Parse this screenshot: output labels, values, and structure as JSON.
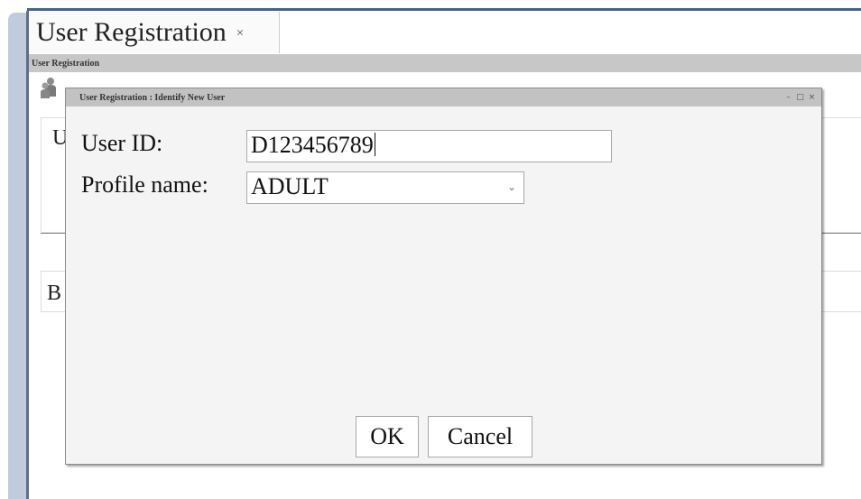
{
  "tab": {
    "title": "User Registration",
    "close_glyph": "×"
  },
  "breadcrumb": "User Registration",
  "background": {
    "fragment_u": "U",
    "fragment_b": "B"
  },
  "dialog": {
    "title": "User Registration : Identify New User",
    "controls": {
      "minimize": "–",
      "maximize": "□",
      "close": "×"
    },
    "user_id_label": "User ID:",
    "user_id_value": "D123456789",
    "profile_label": "Profile name:",
    "profile_value": "ADULT",
    "ok_label": "OK",
    "cancel_label": "Cancel"
  },
  "icons": {
    "app": "user-group-icon",
    "dropdown": "chevron-down-icon"
  },
  "colors": {
    "accent": "#41648a",
    "side_strip": "#c0cbdc",
    "title_bar": "#c2c2c2"
  }
}
